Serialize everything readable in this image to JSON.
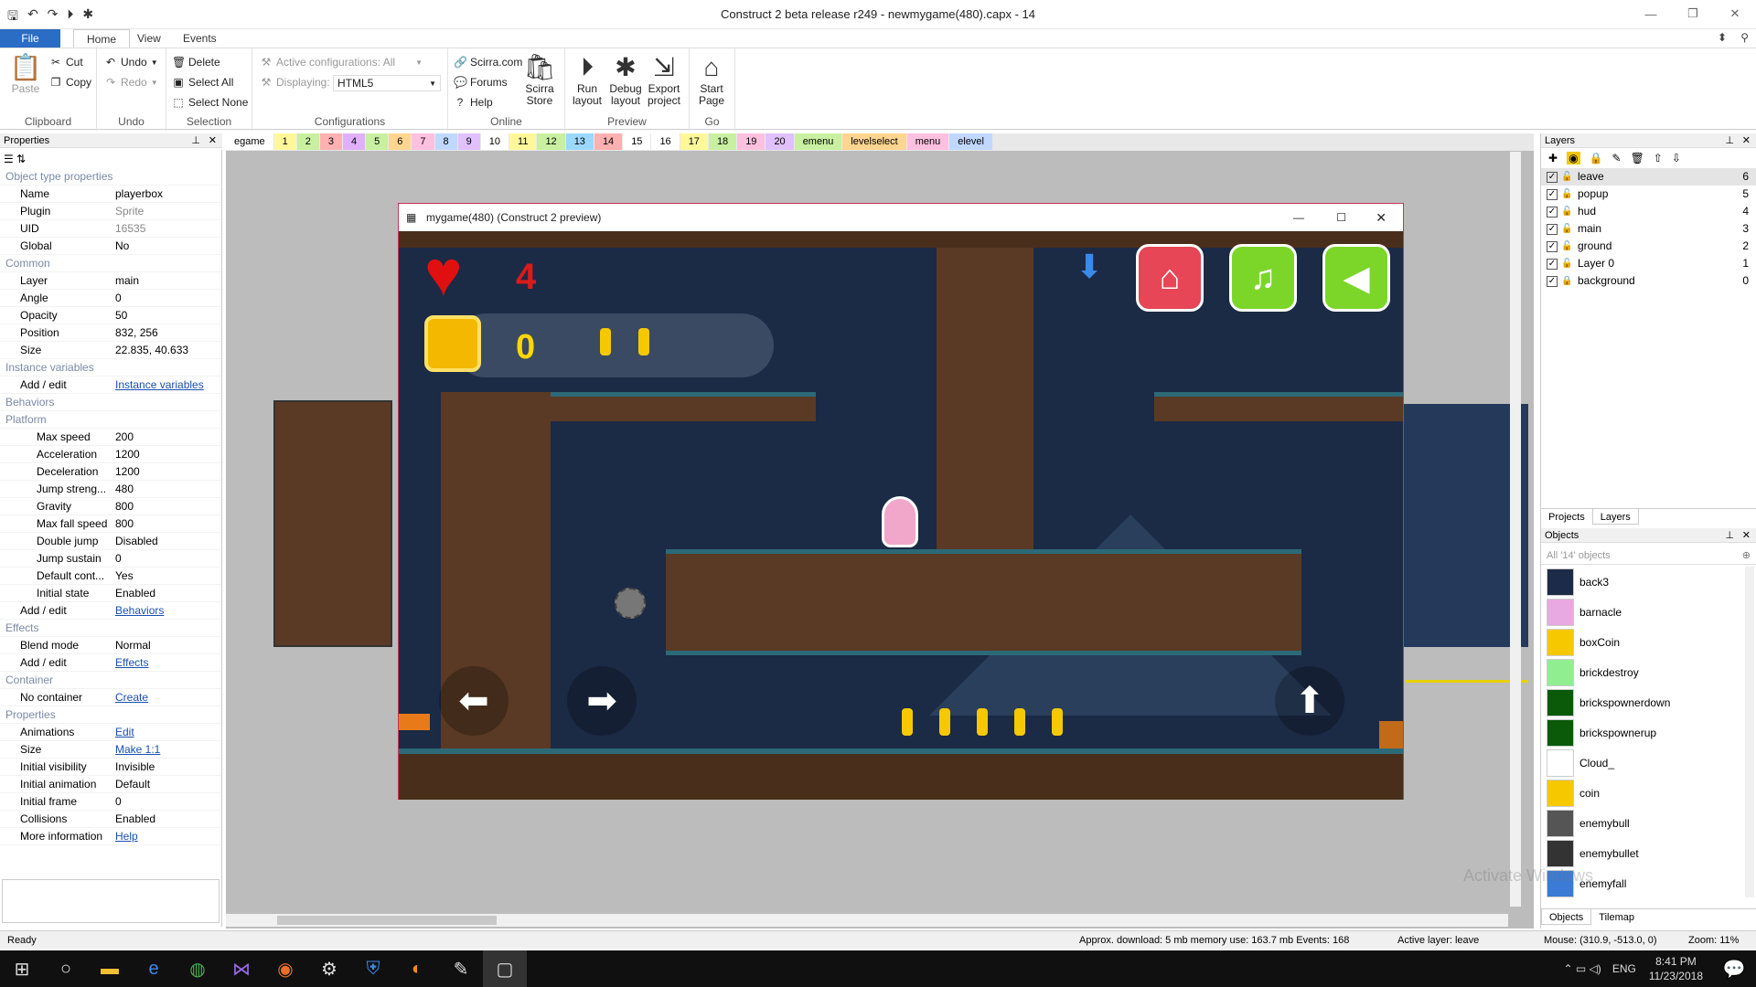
{
  "window": {
    "title": "Construct 2 beta release r249 - newmygame(480).capx - 14"
  },
  "menu": {
    "file": "File",
    "tabs": [
      "Home",
      "View",
      "Events"
    ]
  },
  "ribbon": {
    "clipboard": {
      "label": "Clipboard",
      "paste": "Paste",
      "cut": "Cut",
      "copy": "Copy"
    },
    "undo": {
      "label": "Undo",
      "undo": "Undo",
      "redo": "Redo"
    },
    "selection": {
      "label": "Selection",
      "delete": "Delete",
      "select_all": "Select All",
      "select_none": "Select None"
    },
    "configurations": {
      "label": "Configurations",
      "active": "Active configurations: All",
      "displaying_label": "Displaying:",
      "displaying_value": "HTML5"
    },
    "online": {
      "label": "Online",
      "scirra": "Scirra.com",
      "forums": "Forums",
      "help": "Help",
      "store_1": "Scirra",
      "store_2": "Store"
    },
    "preview": {
      "label": "Preview",
      "run_1": "Run",
      "run_2": "layout",
      "debug_1": "Debug",
      "debug_2": "layout",
      "export_1": "Export",
      "export_2": "project"
    },
    "go": {
      "label": "Go",
      "start_1": "Start",
      "start_2": "Page"
    }
  },
  "properties": {
    "header": "Properties",
    "rows": [
      {
        "k": "Object type properties",
        "t": "sec"
      },
      {
        "k": "Name",
        "v": "playerbox"
      },
      {
        "k": "Plugin",
        "v": "Sprite",
        "c": "grey"
      },
      {
        "k": "UID",
        "v": "16535",
        "c": "grey"
      },
      {
        "k": "Global",
        "v": "No"
      },
      {
        "k": "Common",
        "t": "sec"
      },
      {
        "k": "Layer",
        "v": "main"
      },
      {
        "k": "Angle",
        "v": "0"
      },
      {
        "k": "Opacity",
        "v": "50"
      },
      {
        "k": "Position",
        "v": "832, 256"
      },
      {
        "k": "Size",
        "v": "22.835, 40.633"
      },
      {
        "k": "Instance variables",
        "t": "sec"
      },
      {
        "k": "Add / edit",
        "v": "Instance variables",
        "c": "link"
      },
      {
        "k": "Behaviors",
        "t": "sec"
      },
      {
        "k": "Platform",
        "t": "sec"
      },
      {
        "k": "Max speed",
        "v": "200",
        "t": "sub"
      },
      {
        "k": "Acceleration",
        "v": "1200",
        "t": "sub"
      },
      {
        "k": "Deceleration",
        "v": "1200",
        "t": "sub"
      },
      {
        "k": "Jump streng...",
        "v": "480",
        "t": "sub"
      },
      {
        "k": "Gravity",
        "v": "800",
        "t": "sub"
      },
      {
        "k": "Max fall speed",
        "v": "800",
        "t": "sub"
      },
      {
        "k": "Double jump",
        "v": "Disabled",
        "t": "sub"
      },
      {
        "k": "Jump sustain",
        "v": "0",
        "t": "sub"
      },
      {
        "k": "Default cont...",
        "v": "Yes",
        "t": "sub"
      },
      {
        "k": "Initial state",
        "v": "Enabled",
        "t": "sub"
      },
      {
        "k": "Add / edit",
        "v": "Behaviors",
        "c": "link"
      },
      {
        "k": "Effects",
        "t": "sec"
      },
      {
        "k": "Blend mode",
        "v": "Normal"
      },
      {
        "k": "Add / edit",
        "v": "Effects",
        "c": "link"
      },
      {
        "k": "Container",
        "t": "sec"
      },
      {
        "k": "No container",
        "v": "Create",
        "c": "link"
      },
      {
        "k": "Properties",
        "t": "sec"
      },
      {
        "k": "Animations",
        "v": "Edit",
        "c": "link"
      },
      {
        "k": "Size",
        "v": "Make 1:1",
        "c": "link"
      },
      {
        "k": "Initial visibility",
        "v": "Invisible"
      },
      {
        "k": "Initial animation",
        "v": "Default"
      },
      {
        "k": "Initial frame",
        "v": "0"
      },
      {
        "k": "Collisions",
        "v": "Enabled"
      },
      {
        "k": "More information",
        "v": "Help",
        "c": "link"
      }
    ]
  },
  "layout_tabs": [
    {
      "label": "egame",
      "color": "#ffffff"
    },
    {
      "label": "1",
      "color": "#fff89a"
    },
    {
      "label": "2",
      "color": "#c8f0a0"
    },
    {
      "label": "3",
      "color": "#ffb0b0"
    },
    {
      "label": "4",
      "color": "#e0b0ff"
    },
    {
      "label": "5",
      "color": "#c8f0a0"
    },
    {
      "label": "6",
      "color": "#ffd590"
    },
    {
      "label": "7",
      "color": "#ffc0e0"
    },
    {
      "label": "8",
      "color": "#c0d8ff"
    },
    {
      "label": "9",
      "color": "#e0c0ff"
    },
    {
      "label": "10",
      "color": "#ffffff"
    },
    {
      "label": "11",
      "color": "#fff89a"
    },
    {
      "label": "12",
      "color": "#c8f0a0"
    },
    {
      "label": "13",
      "color": "#9ad8ff"
    },
    {
      "label": "14",
      "color": "#ffb0b0"
    },
    {
      "label": "15",
      "color": "#ffffff"
    },
    {
      "label": "16",
      "color": "#ffffff"
    },
    {
      "label": "17",
      "color": "#fff89a"
    },
    {
      "label": "18",
      "color": "#c8f0a0"
    },
    {
      "label": "19",
      "color": "#ffc0e0"
    },
    {
      "label": "20",
      "color": "#e0c0ff"
    },
    {
      "label": "emenu",
      "color": "#c8f0a0"
    },
    {
      "label": "levelselect",
      "color": "#ffd590"
    },
    {
      "label": "menu",
      "color": "#ffc0e0"
    },
    {
      "label": "elevel",
      "color": "#c0d8ff"
    }
  ],
  "preview": {
    "title": "mygame(480) (Construct 2 preview)",
    "lives": "4",
    "coins": "0"
  },
  "layers": {
    "header": "Layers",
    "rows": [
      {
        "name": "leave",
        "n": "6"
      },
      {
        "name": "popup",
        "n": "5"
      },
      {
        "name": "hud",
        "n": "4"
      },
      {
        "name": "main",
        "n": "3"
      },
      {
        "name": "ground",
        "n": "2"
      },
      {
        "name": "Layer 0",
        "n": "1"
      },
      {
        "name": "background",
        "n": "0"
      }
    ],
    "tabs": [
      "Projects",
      "Layers"
    ]
  },
  "objects": {
    "header": "Objects",
    "filter": "All '14' objects",
    "rows": [
      {
        "name": "back3",
        "color": "#1c2b48"
      },
      {
        "name": "barnacle",
        "color": "#e8a8e0"
      },
      {
        "name": "boxCoin",
        "color": "#f5c800"
      },
      {
        "name": "brickdestroy",
        "color": "#90ee90"
      },
      {
        "name": "brickspownerdown",
        "color": "#0a5a0a"
      },
      {
        "name": "brickspownerup",
        "color": "#0a5a0a"
      },
      {
        "name": "Cloud_",
        "color": "#ffffff"
      },
      {
        "name": "coin",
        "color": "#f5c800"
      },
      {
        "name": "enemybull",
        "color": "#555555"
      },
      {
        "name": "enemybullet",
        "color": "#333333"
      },
      {
        "name": "enemyfall",
        "color": "#3a7bd5"
      }
    ],
    "tabs": [
      "Objects",
      "Tilemap"
    ]
  },
  "status": {
    "left": "Ready",
    "download": "Approx. download: 5 mb  memory use: 163.7 mb  Events: 168",
    "active_layer": "Active layer: leave",
    "mouse": "Mouse: (310.9, -513.0, 0)",
    "zoom": "Zoom: 11%"
  },
  "watermark": "Activate Windows",
  "taskbar": {
    "time": "8:41 PM",
    "date": "11/23/2018",
    "lang": "ENG"
  }
}
